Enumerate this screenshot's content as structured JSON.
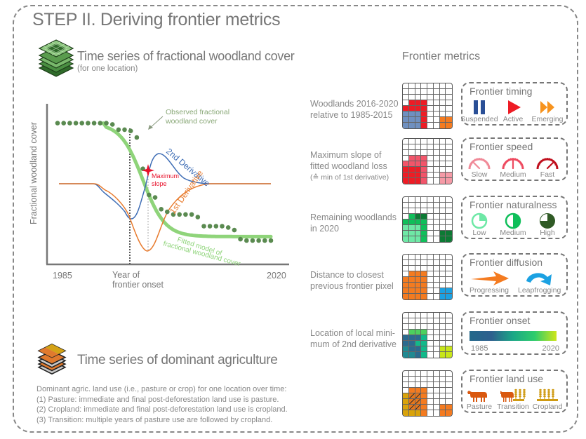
{
  "title": "STEP II. Deriving frontier metrics",
  "woodland_section": {
    "icon": "layer-stack-green-icon",
    "title": "Time series of fractional woodland cover",
    "subtitle": "(for one location)"
  },
  "agri_section": {
    "icon": "layer-stack-agri-icon",
    "title": "Time series of dominant agriculture",
    "lines": [
      "Dominant agric. land use (i.e., pasture or crop) for one location over time:",
      "(1) Pasture: immediate and final post-deforestation land use is pasture.",
      "(2) Cropland: immediate and final post-deforestation land use is cropland.",
      "(3) Transition: multiple years of pasture use are followed by cropland."
    ]
  },
  "chart_data": {
    "type": "line",
    "title": "",
    "ylabel": "Fractional woodland cover",
    "xlabel": "Year of frontier onset",
    "x_tick_labels": [
      "1985",
      "2020"
    ],
    "x_annotation": "Year of\nfrontier onset",
    "xlim": [
      1985,
      2020
    ],
    "ylim": [
      0,
      1
    ],
    "observed_points": {
      "name": "Observed fractional woodland cover",
      "color": "#5a8a50",
      "x": [
        1985,
        1986,
        1987,
        1988,
        1989,
        1990,
        1991,
        1992,
        1993,
        1994,
        1995,
        1996,
        1997,
        1998,
        1999,
        2000,
        2001,
        2002,
        2003,
        2004,
        2005,
        2006,
        2007,
        2008,
        2009,
        2010,
        2011,
        2012,
        2013,
        2014,
        2015,
        2016,
        2017,
        2018,
        2019,
        2020
      ],
      "y": [
        0.97,
        0.97,
        0.97,
        0.97,
        0.97,
        0.97,
        0.97,
        0.97,
        0.97,
        0.96,
        0.92,
        0.92,
        0.91,
        0.86,
        0.62,
        0.42,
        0.4,
        0.31,
        0.29,
        0.27,
        0.27,
        0.27,
        0.27,
        0.25,
        0.18,
        0.18,
        0.18,
        0.18,
        0.17,
        0.15,
        0.08,
        0.07,
        0.07,
        0.07,
        0.07,
        0.07
      ]
    },
    "fitted_model": {
      "name": "Fitted model of fractional woodland cover",
      "color": "#8fd47a"
    },
    "first_derivative": {
      "name": "1st Derivative",
      "color": "#e87b2e"
    },
    "second_derivative": {
      "name": "2nd Derivative",
      "color": "#3e6db5"
    },
    "markers": [
      {
        "label": "Maximum slope",
        "color": "#e8102a",
        "x": 1999
      }
    ],
    "onset_year_marker": 1996,
    "labels": {
      "observed": [
        "Observed fractional",
        "woodland cover"
      ],
      "second": "2nd Derivative",
      "first": "1st Derivative",
      "fitted": [
        "Fitted model of",
        "fractional woodland cover"
      ],
      "max_slope": [
        "Maximum",
        "slope"
      ]
    }
  },
  "metrics_title": "Frontier metrics",
  "metrics": [
    {
      "label": [
        "Woodlands 2016-2020",
        "relative to 1985-2015"
      ],
      "grid": [
        "........",
        ".........",
        "........",
        ".RRR....",
        "RRRR....",
        "BBBR....",
        "BBBR..OO",
        "BBBR..OO"
      ],
      "palette": {
        "R": "#ee1c25",
        "B": "#6f90c0",
        "O": "#f47b20"
      },
      "box_title": "Frontier timing",
      "items": [
        {
          "caption": "Suspended",
          "icon": "pause-icon",
          "color": "#2a4f96"
        },
        {
          "caption": "Active",
          "icon": "play-icon",
          "color": "#ee1c25"
        },
        {
          "caption": "Emerging",
          "icon": "fast-forward-icon",
          "color": "#f7931e"
        }
      ]
    },
    {
      "label": [
        "Maximum slope of",
        "fitted woodland loss",
        "(≙ min of 1st derivative)"
      ],
      "grid": [
        "........",
        "........",
        "........",
        ".MMM....",
        "MMMM....",
        "RRRM....",
        "RRRM..LL",
        "RRRM..LL"
      ],
      "palette": {
        "R": "#ee1c25",
        "M": "#f2556a",
        "L": "#f59aa6"
      },
      "box_title": "Frontier speed",
      "items": [
        {
          "caption": "Slow",
          "icon": "gauge-slow-icon",
          "color": "#f08a98"
        },
        {
          "caption": "Medium",
          "icon": "gauge-medium-icon",
          "color": "#ee4b60"
        },
        {
          "caption": "Fast",
          "icon": "gauge-fast-icon",
          "color": "#c0101e"
        }
      ]
    },
    {
      "label": [
        "Remaining woodlands",
        "in 2020"
      ],
      "grid": [
        "........",
        "........",
        "........",
        ".MDD....",
        "MMMM....",
        "LLLM....",
        "LLLM..DD",
        "LLLM..DD"
      ],
      "palette": {
        "L": "#6ee8a6",
        "M": "#0fbf5a",
        "D": "#0c7a34"
      },
      "box_title": "Frontier naturalness",
      "items": [
        {
          "caption": "Low",
          "icon": "pie-quarter-icon",
          "color": "#6ee8a6"
        },
        {
          "caption": "Medium",
          "icon": "pie-half-icon",
          "color": "#0fbf5a"
        },
        {
          "caption": "High",
          "icon": "pie-three-quarter-icon",
          "color": "#2f5a25"
        }
      ]
    },
    {
      "label": [
        "Distance to closest",
        "previous frontier pixel"
      ],
      "grid": [
        "........",
        "........",
        "........",
        ".OOO....",
        "OOOO....",
        "OOOO....",
        "OOOO..BB",
        "OOOO..BB"
      ],
      "palette": {
        "O": "#f47b20",
        "B": "#1ba1e2"
      },
      "box_title": "Frontier diffusion",
      "items": [
        {
          "caption": "Progressing",
          "icon": "arrow-right-icon",
          "color": "#f47b20"
        },
        {
          "caption": "Leapfrogging",
          "icon": "curved-arrow-icon",
          "color": "#1ba1e2"
        }
      ]
    },
    {
      "label": [
        "Location of local mini-",
        "mum of 2nd derivative"
      ],
      "grid": [
        "........",
        "........",
        "........",
        ".GGG....",
        "DDDT....",
        "DDTT....",
        "EDDT..YY",
        "EEDT..YY"
      ],
      "palette": {
        "G": "#4cd15e",
        "D": "#2b6b8f",
        "T": "#11b98a",
        "E": "#1f8a92",
        "Y": "#c8e619"
      },
      "box_title": "Frontier onset",
      "colorbar": {
        "from": "1985",
        "to": "2020",
        "colors": [
          "#23688a",
          "#2e5f8e",
          "#1ba786",
          "#2ecc6c",
          "#cfe619"
        ]
      }
    },
    {
      "label": [],
      "grid": [
        "........",
        "........",
        "........",
        ".OOO....",
        "YSSO....",
        "YSSO....",
        "YSSO..OO",
        "YYYO..OO"
      ],
      "palette": {
        "O": "#f47b20",
        "Y": "#d9a30a",
        "S": "#e8761a"
      },
      "box_title": "Frontier land use",
      "items": [
        {
          "caption": "Pasture",
          "icon": "cow-icon",
          "color": "#d9580f"
        },
        {
          "caption": "Transition",
          "icon": "cow-wheat-icon",
          "color": "#d9580f"
        },
        {
          "caption": "Cropland",
          "icon": "wheat-icon",
          "color": "#cf9a12"
        }
      ]
    }
  ]
}
